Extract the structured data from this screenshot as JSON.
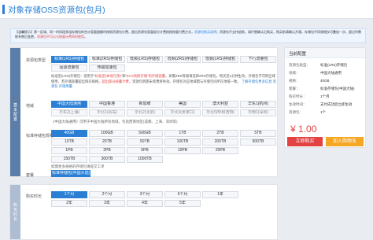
{
  "page_title": "对象存储OSS资源包(包月)",
  "notice": {
    "prefix": "【温馨提示】",
    "text1": "第一区域、同一时间段多组存储包的合计容量超额时按照资源包计费，超出资源包容量部分计费按照按量付费方式，",
    "link": "资源包购买说明",
    "text2": "；资源包不支持退款，请仔细确认后购买，购买前请确认开通，存储包不同规格仅可叠加一次，超过时需联系售后变更。",
    "warn": "资源包不可以与按量计费同时使用。"
  },
  "spec": {
    "label": "资源包类型",
    "options_row1": [
      "标准(LRS)存储包",
      "标准(ZRS)存储包",
      "低频(LRS)存储包",
      "低频(ZRS)存储包",
      "低频(LRS)存储包",
      "下行流量包"
    ],
    "options_row2": [
      "回源流量包",
      "传输加速包"
    ],
    "desc_parts": {
      "a": "标准型(LRS)存储包：适用于",
      "b": "\"标准型(本地冗余)\"",
      "c": "和",
      "d": "\"ECS快照存储\"",
      "e": "的存储容量",
      "f": "，如需ZRS等级请选择ZRS存储包。购买后1分钟生效，存储包不可跨区域使用，若存储容量超出购买规格，",
      "g": "超出部分按量计费",
      "h": "，资源包到期未续费将失效。存储包对应地域需与存储空间所在地域一致。",
      "i": "了解存储包更多信息",
      "j": "资源包",
      "k": "存储用量"
    }
  },
  "region": {
    "label": "地域",
    "options_row1": [
      "中国大陆通用",
      "中国香港",
      "新加坡",
      "美国",
      "澳大利亚",
      "华东1(杭州)"
    ],
    "options_row2": [
      "华东2(上海)",
      "华北1(青岛)",
      "华北2(北京)",
      "华北3(张家口)",
      "华北5(呼和浩特)",
      "华南1(深圳)"
    ],
    "hint": "《中国大陆通用》可用于中国大陆所有地域，包括西南地区(成都、上海、深圳等)"
  },
  "capacity": {
    "label": "标准存储包规格",
    "options_row1": [
      "40GB",
      "100GB",
      "500GB",
      "1TB",
      "2TB",
      "5TB"
    ],
    "options_row2": [
      "10TB",
      "20TB",
      "50TB",
      "100TB",
      "200TB",
      "500TB"
    ],
    "options_row3": [
      "1PB",
      "2PB",
      "5PB",
      "10PB",
      "20PB"
    ],
    "options_row4": [
      "150TB",
      "300TB",
      "1000TB"
    ],
    "hint": "如需更多规格的存储包请提交工单"
  },
  "package": {
    "label": "套餐",
    "selected": "标准存储包(中国大陆)"
  },
  "duration": {
    "label": "购买时长",
    "options_row1": [
      "1个月",
      "2个月",
      "3个月",
      "6个月",
      "1年"
    ],
    "options_row2": [
      "2年",
      "3年",
      "4年",
      "5年"
    ]
  },
  "summary": {
    "title": "当前配置",
    "rows": [
      {
        "k": "资源包类型：",
        "v": "标准(LRS)存储包"
      },
      {
        "k": "地域：",
        "v": "中国大陆通用"
      },
      {
        "k": "规格：",
        "v": "40GB"
      },
      {
        "k": "套餐：",
        "v": "标准存储包(中国大陆)"
      },
      {
        "k": "购买时长：",
        "v": "1个月"
      },
      {
        "k": "生效时间：",
        "v": "支付成功后立即生效"
      },
      {
        "k": "资源包：",
        "v": "1个"
      }
    ],
    "price": "¥ 1.00",
    "buy_label": "立即购买",
    "cart_label": "加入购物车"
  },
  "side_tabs": {
    "main": "基本配置",
    "duration": "购买时长"
  }
}
